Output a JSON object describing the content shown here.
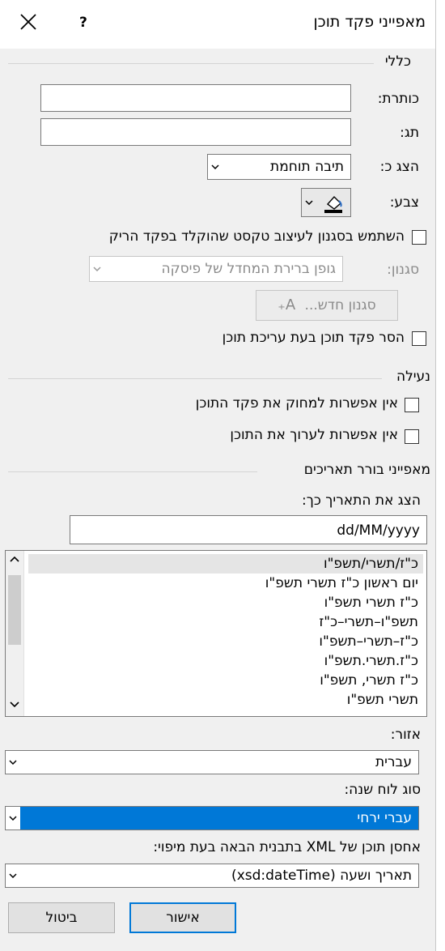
{
  "title": "מאפייני פקד תוכן",
  "help_label": "?",
  "general": {
    "heading": "כללי",
    "title_label": "כותרת:",
    "title_value": "",
    "tag_label": "תג:",
    "tag_value": "",
    "show_as_label": "הצג כ:",
    "show_as_value": "תיבה תוחמת",
    "color_label": "צבע:",
    "use_style_label": "השתמש בסגנון לעיצוב טקסט שהוקלד בפקד הריק",
    "style_label": "סגנון:",
    "style_value": "גופן ברירת המחדל של פיסקה",
    "new_style_label": "סגנון חדש...",
    "remove_label": "הסר פקד תוכן בעת עריכת תוכן"
  },
  "locking": {
    "heading": "נעילה",
    "no_delete_label": "אין אפשרות למחוק את פקד התוכן",
    "no_edit_label": "אין אפשרות לערוך את התוכן"
  },
  "date_picker": {
    "heading": "מאפייני בורר תאריכים",
    "format_label": "הצג את התאריך כך:",
    "format_value": "dd/MM/yyyy",
    "formats": [
      "כ\"ז/תשרי/תשפ\"ו",
      "יום ראשון כ\"ז תשרי תשפ\"ו",
      "כ\"ז תשרי תשפ\"ו",
      "תשפ\"ו–תשרי–כ\"ז",
      "כ\"ז–תשרי–תשפ\"ו",
      "כ\"ז.תשרי.תשפ\"ו",
      "כ\"ז תשרי, תשפ\"ו",
      "תשרי תשפ\"ו"
    ],
    "locale_label": "אזור:",
    "locale_value": "עברית",
    "calendar_label": "סוג לוח שנה:",
    "calendar_value": "עברי ירחי",
    "mapping_label": "אחסן תוכן של XML בתבנית הבאה בעת מיפוי:",
    "mapping_value": "תאריך ושעה (xsd:dateTime)"
  },
  "buttons": {
    "ok": "אישור",
    "cancel": "ביטול"
  },
  "colors": {
    "selection": "#0078d7",
    "primary_border": "#0078d7"
  }
}
